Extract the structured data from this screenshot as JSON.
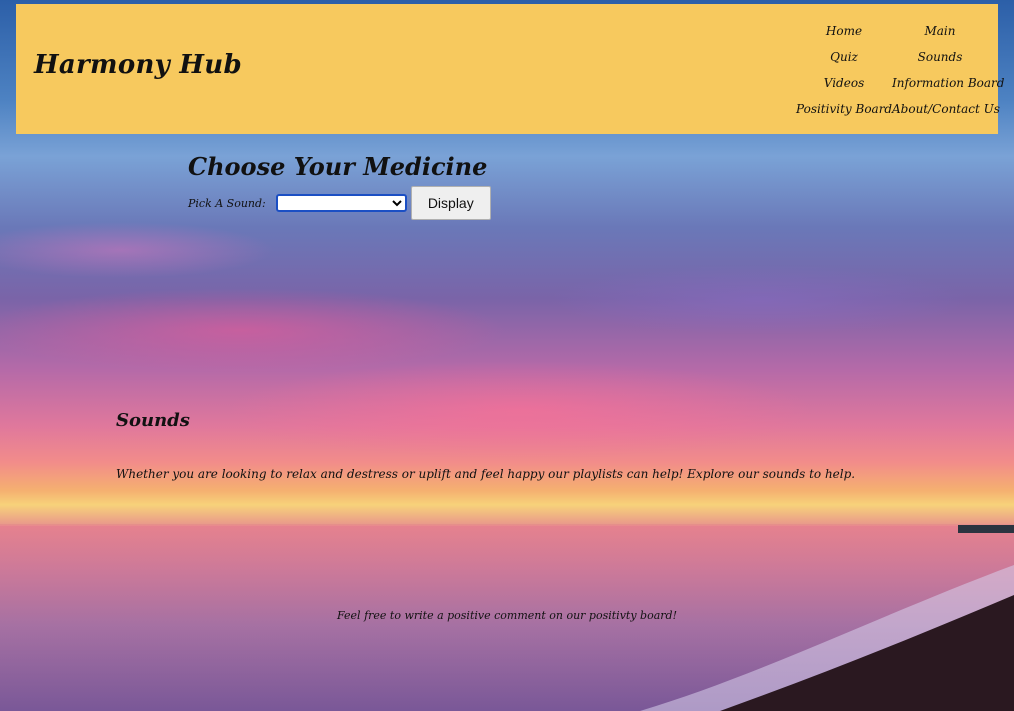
{
  "header": {
    "logo": "Harmony Hub",
    "nav": [
      {
        "label": "Home"
      },
      {
        "label": "Main"
      },
      {
        "label": "Quiz"
      },
      {
        "label": "Sounds"
      },
      {
        "label": "Videos"
      },
      {
        "label": "Information Board"
      },
      {
        "label": "Positivity Board"
      },
      {
        "label": "About/Contact Us"
      }
    ]
  },
  "medicine": {
    "title": "Choose Your Medicine",
    "pick_label": "Pick A Sound:",
    "select_value": "",
    "display_button": "Display"
  },
  "sounds": {
    "title": "Sounds",
    "description": "Whether you are looking to relax and destress or uplift and feel happy our playlists can help! Explore our sounds to help."
  },
  "footer": {
    "note": "Feel free to write a positive comment on our positivty board!"
  },
  "colors": {
    "header_bg": "#f7c95e",
    "select_border": "#1b4fc4"
  }
}
